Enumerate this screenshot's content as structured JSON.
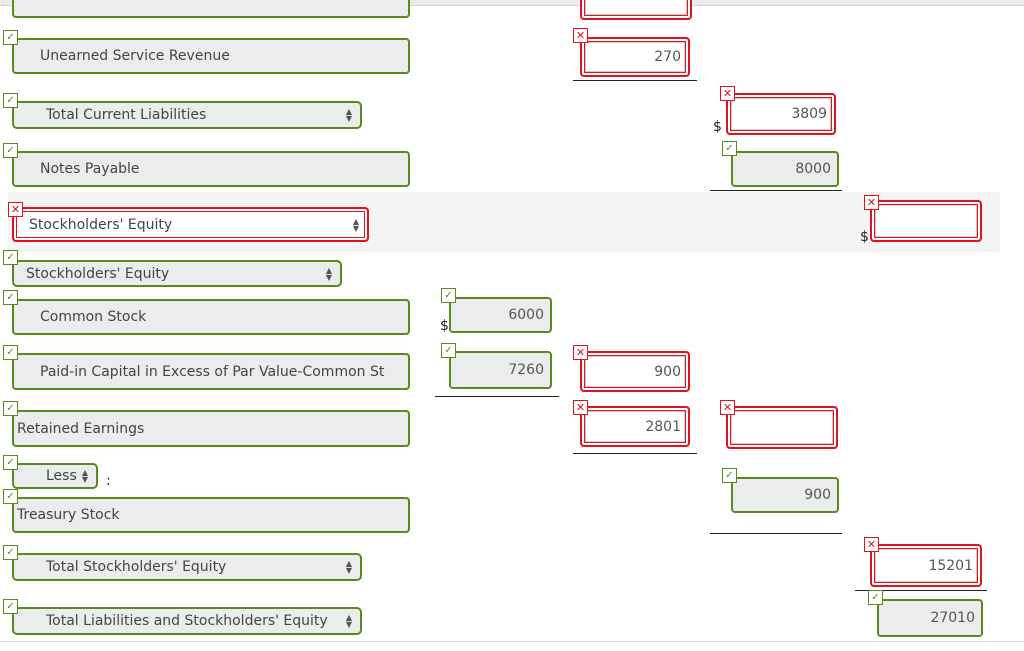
{
  "labels": {
    "unearned": "Unearned Service Revenue",
    "total_current": "Total Current Liabilities",
    "notes": "Notes Payable",
    "se_heading_wrong": "Stockholders' Equity",
    "se_heading": "Stockholders' Equity",
    "common": "Common Stock",
    "paid_in": "Paid-in Capital in Excess of Par Value-Common St",
    "retained": "Retained Earnings",
    "less": "Less",
    "colon": ":",
    "treasury": "Treasury Stock",
    "total_se": "Total Stockholders' Equity",
    "total_lse": "Total Liabilities and Stockholders' Equity"
  },
  "values": {
    "unearned": "270",
    "total_current": "3809",
    "notes": "8000",
    "se_total_top": "",
    "common": "6000",
    "paid_in_col1": "7260",
    "paid_in_col2": "900",
    "retained": "2801",
    "retained_col3": "",
    "treasury": "900",
    "total_se": "15201",
    "total_lse": "27010"
  },
  "currency": "$",
  "icons": {
    "correct": "✓",
    "incorrect": "✕"
  },
  "colors": {
    "correct": "#5a8a1e",
    "incorrect": "#e0141e"
  }
}
